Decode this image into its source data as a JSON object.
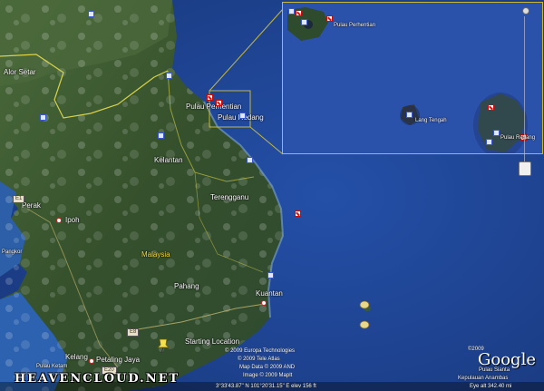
{
  "map": {
    "places": {
      "alor_setar": "Alor Setar",
      "perak": "Perak",
      "ipoh": "Ipoh",
      "pangkor": "Pangkor",
      "kelantan": "Kelantan",
      "terengganu": "Terengganu",
      "malaysia": "Malaysia",
      "pahang": "Pahang",
      "kuantan": "Kuantan",
      "pulau_perhentian": "Pulau Perhentian",
      "pulau_redang": "Pulau Redang",
      "kelang": "Kelang",
      "petaling_jaya": "Petaling Jaya",
      "pulau_ketam": "Pulau Ketam",
      "pulau_sianta": "Pulau Sianta",
      "kepulauan_anambas": "Kepulauan Anambas",
      "starting_location": "Starting Location"
    },
    "roads": {
      "r1": "E1",
      "r2": "E8",
      "r3": "E20"
    },
    "inset": {
      "perhentian": "Pulau Perhentian",
      "lang_tengah": "Lang Tengah",
      "redang": "Pulau Redang"
    }
  },
  "credits": {
    "europa": "© 2009 Europa Technologies",
    "tele_atlas": "© 2009 Tele Atlas",
    "map_data": "Map Data © 2009 AND",
    "image": "Image © 2009 MapIt",
    "year": "©2009"
  },
  "status": {
    "coords": "3°33'43.87\" N 101°20'31.15\" E   elev  156 ft",
    "eye": "Eye alt  342.40 mi"
  },
  "branding": {
    "watermark": "HEAVENCLOUD.NET",
    "google": "Google"
  },
  "colors": {
    "sea": "#1e3f8c",
    "land": "#3d5a32",
    "border": "#d8d24a",
    "dive_marker": "#d01a1a"
  }
}
